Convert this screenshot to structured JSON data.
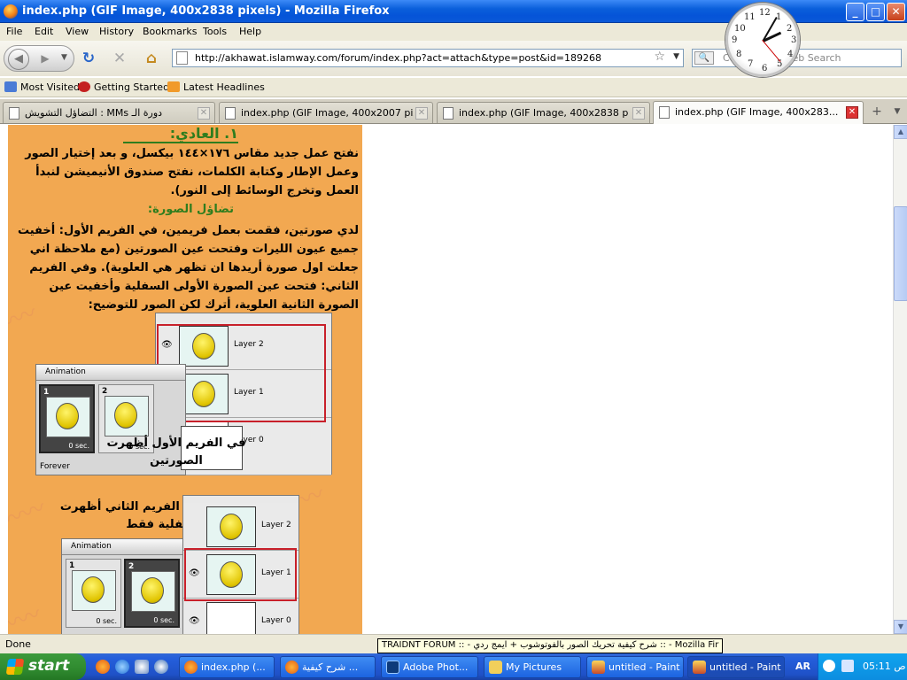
{
  "window": {
    "title": "index.php (GIF Image, 400x2838 pixels) - Mozilla Firefox",
    "minimize": "_",
    "maximize": "□",
    "close": "✕"
  },
  "menu": [
    "File",
    "Edit",
    "View",
    "History",
    "Bookmarks",
    "Tools",
    "Help"
  ],
  "nav": {
    "url": "http://akhawat.islamway.com/forum/index.php?act=attach&type=post&id=189268",
    "search_placeholder": "Customized Web Search"
  },
  "bookmarks": [
    {
      "label": "Most Visited",
      "icon": "most-visited-icon"
    },
    {
      "label": "Getting Started",
      "icon": "getting-started-icon"
    },
    {
      "label": "Latest Headlines",
      "icon": "rss-icon"
    }
  ],
  "tabs": [
    {
      "label": "التضاؤل التشويش : MMs دورة الـ",
      "active": false
    },
    {
      "label": "index.php (GIF Image, 400x2007 pix...",
      "active": false
    },
    {
      "label": "index.php (GIF Image, 400x2838 pix...",
      "active": false
    },
    {
      "label": "index.php (GIF Image, 400x283...",
      "active": true
    }
  ],
  "gif": {
    "heading": "١. العادي:",
    "para1": "نفتح عمل جديد مقاس ١٧٦×١٤٤ بيكسل، و بعد إختيار الصور وعمل الإطار وكتابة الكلمات، نفتح صندوق الأنيميشن لنبدأ العمل وتخرج الوسائط إلى النور).",
    "subheading": "تضاؤل الصورة:",
    "para2": "لدي صورتين، فقمت بعمل فريمين، في الفريم الأول: أخفيت جميع عيون الليرات وفتحت عين الصورتين (مع ملاحظة اني جعلت اول صورة أريدها ان تظهر هي العلوية). وفي الفريم الثاني: فتحت عين الصورة الأولى السفلية وأخفيت عين الصورة الثانية العلوية، أترك لكن الصور للتوضيح:",
    "caption1": "في الفريم الأول أظهرت الصورتين",
    "caption2": "في الفريم الثاني أظهرت السفلية فقط",
    "layers": [
      "Layer 2",
      "Layer 1",
      "Layer 0"
    ],
    "animation_label": "Animation",
    "frame_delay": "0 sec.",
    "loop": "Forever",
    "frame_numbers": [
      "1",
      "2"
    ]
  },
  "status": {
    "text": "Done",
    "tooltip": "TRAIDNT FORUM :: - شرح كيفية تحريك الصور بالفوتوشوب + ايمج ردي :: - Mozilla Fir"
  },
  "clock": {
    "numbers": [
      "12",
      "1",
      "2",
      "3",
      "4",
      "5",
      "6",
      "7",
      "8",
      "9",
      "10",
      "11"
    ]
  },
  "taskbar": {
    "start": "start",
    "items": [
      {
        "label": "index.php (...",
        "icon": "firefox-icon",
        "active": false
      },
      {
        "label": "شرح كيفية ...",
        "icon": "firefox-icon",
        "active": false
      },
      {
        "label": "Adobe Phot...",
        "icon": "photoshop-icon",
        "active": false
      },
      {
        "label": "My Pictures",
        "icon": "folder-icon",
        "active": false
      },
      {
        "label": "untitled - Paint",
        "icon": "paint-icon",
        "active": false
      },
      {
        "label": "untitled - Paint",
        "icon": "paint-icon",
        "active": false
      }
    ],
    "lang": "AR",
    "time": "05:11 ص"
  }
}
